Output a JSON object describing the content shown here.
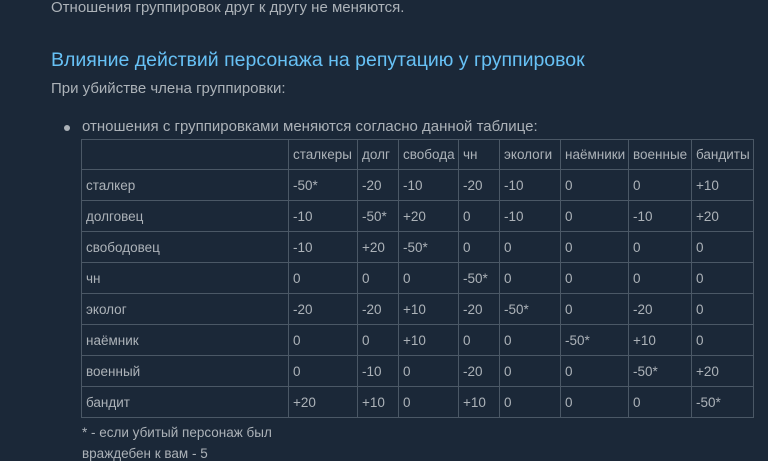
{
  "page": {
    "top_text": "Отношения группировок друг к другу не меняются.",
    "section_title": "Влияние действий персонажа на репутацию у группировок",
    "intro": "При убийстве члена группировки:",
    "bullet": "отношения с группировками меняются согласно данной таблице:",
    "note_line1": "* - если убитый персонаж был",
    "note_line2": "враждебен к вам - 5"
  },
  "table": {
    "columns": [
      "",
      "сталкеры",
      "долг",
      "свобода",
      "чн",
      "экологи",
      "наёмники",
      "военные",
      "бандиты"
    ],
    "rows": [
      [
        "сталкер",
        "-50*",
        "-20",
        "-10",
        "-20",
        "-10",
        "0",
        "0",
        "+10"
      ],
      [
        "долговец",
        "-10",
        "-50*",
        "+20",
        "0",
        "-10",
        "0",
        "-10",
        "+20"
      ],
      [
        "свободовец",
        "-10",
        "+20",
        "-50*",
        "0",
        "0",
        "0",
        "0",
        "0"
      ],
      [
        "чн",
        "0",
        "0",
        "0",
        "-50*",
        "0",
        "0",
        "0",
        "0"
      ],
      [
        "эколог",
        "-20",
        "-20",
        "+10",
        "-20",
        "-50*",
        "0",
        "-20",
        "0"
      ],
      [
        "наёмник",
        "0",
        "0",
        "+10",
        "0",
        "0",
        "-50*",
        "+10",
        "0"
      ],
      [
        "военный",
        "0",
        "-10",
        "0",
        "-20",
        "0",
        "0",
        "-50*",
        "+20"
      ],
      [
        "бандит",
        "+20",
        "+10",
        "0",
        "+10",
        "0",
        "0",
        "0",
        "-50*"
      ]
    ]
  },
  "colors": {
    "background": "#1b2838",
    "text": "#acb2b8",
    "heading": "#67c1f5",
    "border": "#4b5866"
  }
}
